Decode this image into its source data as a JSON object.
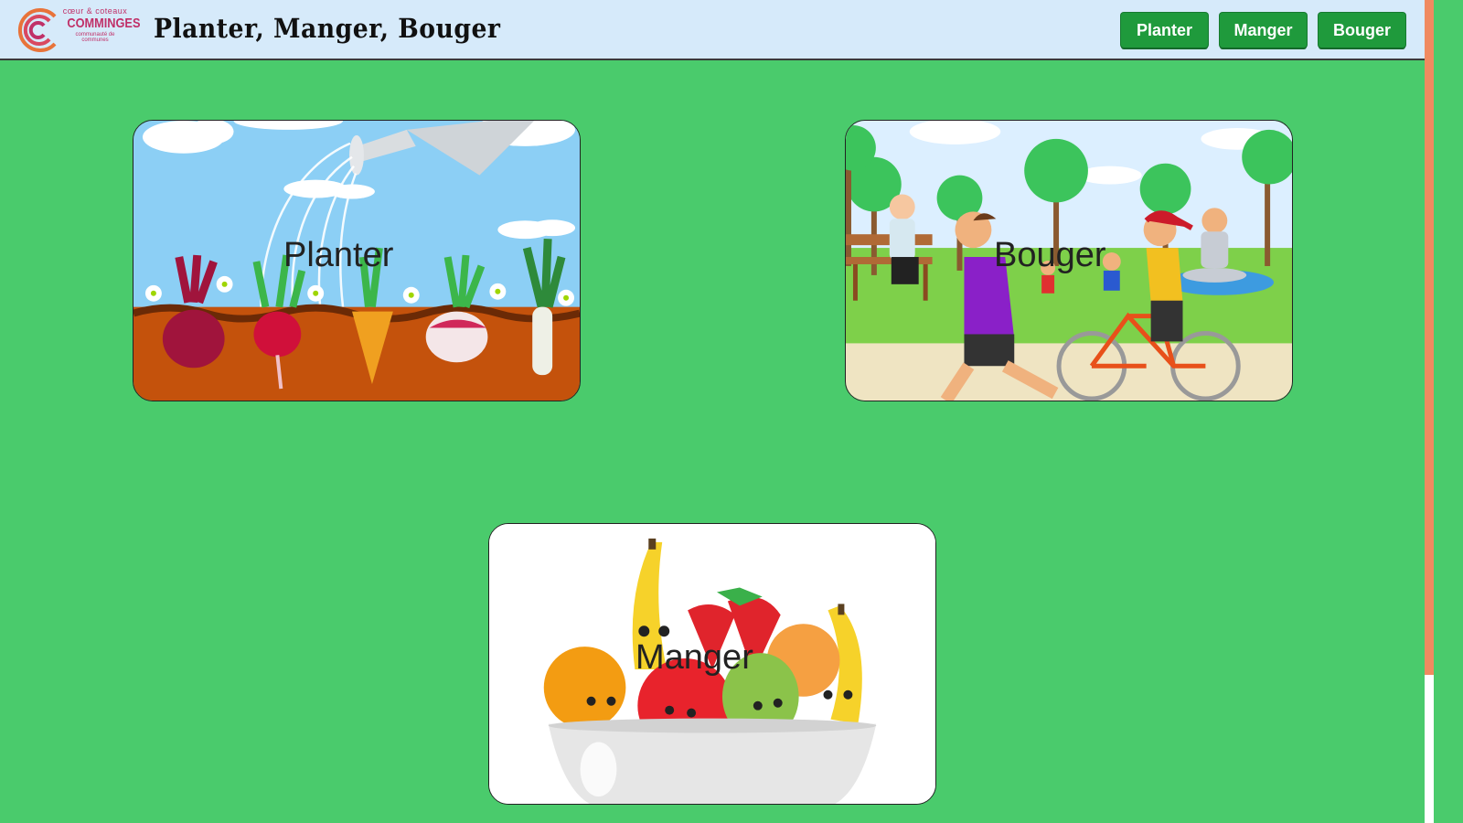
{
  "header": {
    "logo": {
      "line1": "cœur & coteaux",
      "line2": "COMMINGES",
      "line3": "communauté de communes"
    },
    "title": "Planter, Manger, Bouger",
    "nav": [
      {
        "label": "Planter"
      },
      {
        "label": "Manger"
      },
      {
        "label": "Bouger"
      }
    ]
  },
  "cards": {
    "planter": {
      "label": "Planter",
      "illustration": "vegetables-growing-watering-can"
    },
    "bouger": {
      "label": "Bouger",
      "illustration": "park-people-exercising"
    },
    "manger": {
      "label": "Manger",
      "illustration": "fruit-bowl"
    }
  },
  "colors": {
    "background": "#4acb6c",
    "header": "#d6eafa",
    "button": "#1f9a3c",
    "logo": "#c03068"
  }
}
